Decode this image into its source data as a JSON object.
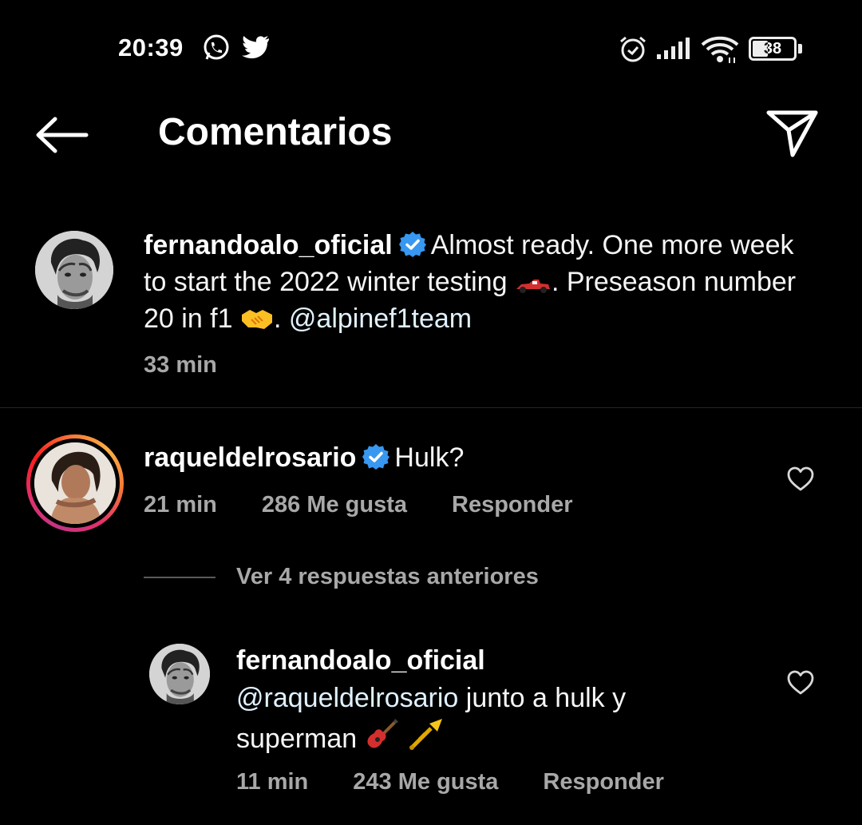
{
  "status_bar": {
    "time": "20:39",
    "battery": "38",
    "battery_level": 0.38,
    "icons": [
      "whatsapp-icon",
      "twitter-icon",
      "alarm-icon",
      "signal-icon",
      "wifi-icon",
      "battery-icon"
    ]
  },
  "header": {
    "title": "Comentarios",
    "back_icon": "arrow-left-icon",
    "share_icon": "send-icon"
  },
  "caption": {
    "username": "fernandoalo_oficial",
    "verified": true,
    "text_1": "Almost ready. One more week to start the 2022 winter testing",
    "emoji_1": "racing-car",
    "text_2": ". Preseason number 20 in f1",
    "emoji_2": "handshake",
    "text_3": ".",
    "mention": "@alpinef1team",
    "time": "33 min"
  },
  "comments": [
    {
      "username": "raqueldelrosario",
      "verified": true,
      "text": "Hulk?",
      "time": "21 min",
      "likes": "286 Me gusta",
      "reply_label": "Responder",
      "has_story_ring": true
    }
  ],
  "view_replies_label": "Ver 4 respuestas anteriores",
  "replies": [
    {
      "username": "fernandoalo_oficial",
      "mention": "@raqueldelrosario",
      "text": "junto a hulk y superman",
      "emojis": [
        "guitar",
        "trumpet"
      ],
      "time": "11 min",
      "likes": "243 Me gusta",
      "reply_label": "Responder"
    }
  ],
  "colors": {
    "background": "#000000",
    "text": "#f5f5f5",
    "muted": "#a8a8a8",
    "verified": "#3897f0",
    "mention": "#e0f1ff"
  }
}
